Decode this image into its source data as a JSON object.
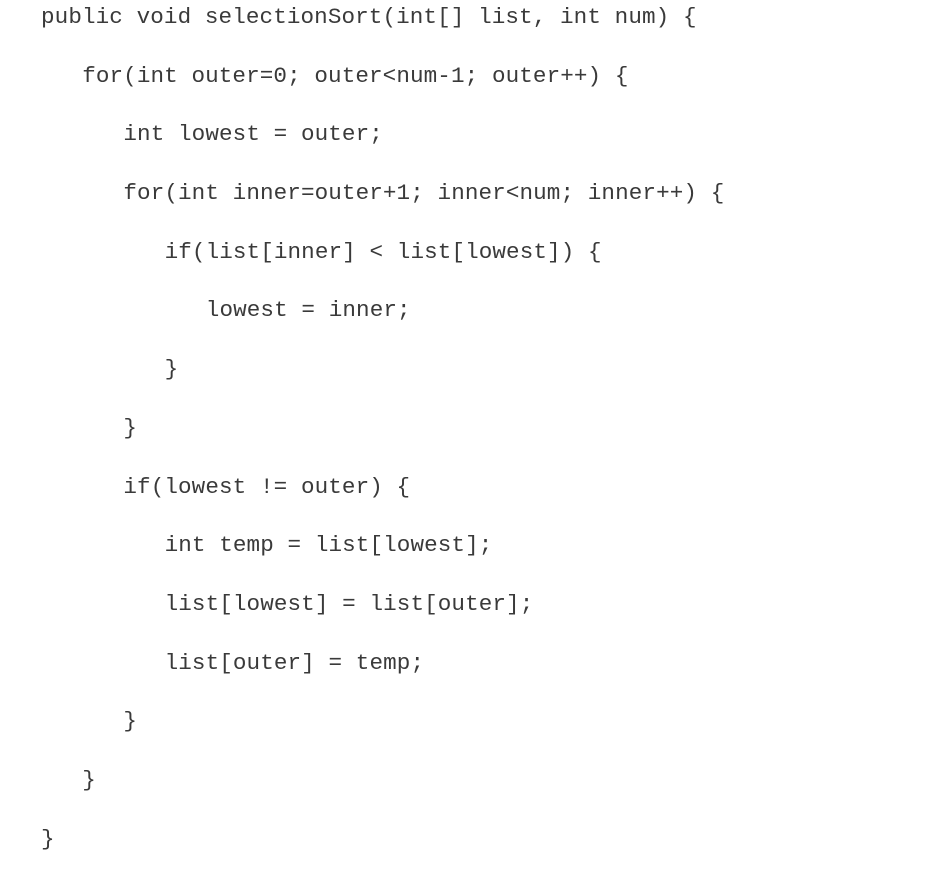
{
  "code": {
    "language": "java",
    "lines": [
      {
        "indent": 0,
        "text": "public void selectionSort(int[] list, int num) {"
      },
      {
        "indent": 1,
        "text": "for(int outer=0; outer<num-1; outer++) {"
      },
      {
        "indent": 2,
        "text": "int lowest = outer;"
      },
      {
        "indent": 2,
        "text": "for(int inner=outer+1; inner<num; inner++) {"
      },
      {
        "indent": 3,
        "text": "if(list[inner] < list[lowest]) {"
      },
      {
        "indent": 4,
        "text": "lowest = inner;"
      },
      {
        "indent": 3,
        "text": "}"
      },
      {
        "indent": 2,
        "text": "}"
      },
      {
        "indent": 2,
        "text": "if(lowest != outer) {"
      },
      {
        "indent": 3,
        "text": "int temp = list[lowest];"
      },
      {
        "indent": 3,
        "text": "list[lowest] = list[outer];"
      },
      {
        "indent": 3,
        "text": "list[outer] = temp;"
      },
      {
        "indent": 2,
        "text": "}"
      },
      {
        "indent": 1,
        "text": "}"
      },
      {
        "indent": 0,
        "text": "}"
      }
    ]
  }
}
